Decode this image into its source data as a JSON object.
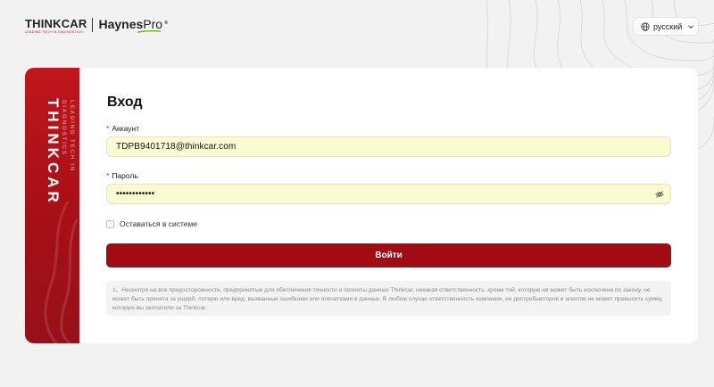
{
  "header": {
    "logo_thinkcar": "THINKCAR",
    "logo_thinkcar_tagline": "LEADING TECH IN DIAGNOSTICS",
    "logo_haynes": "Haynes",
    "logo_pro": "Pro",
    "logo_reg": "®",
    "language": "русский"
  },
  "banner": {
    "brand": "THINKCAR",
    "tagline_line1": "LEADING TECH IN",
    "tagline_line2": "DIAGNOSTICS"
  },
  "login": {
    "title": "Вход",
    "account_label": "Аккаунт",
    "account_value": "TDPB9401718@thinkcar.com",
    "password_label": "Пароль",
    "password_value": "••••••••••••",
    "remember_label": "Оставаться в системе",
    "submit_label": "Войти",
    "disclaimer": "1、Несмотря на все предосторожности, предпринятые для обеспечения точности и полноты данных Thinkcar, никакая ответственность, кроме той, которую не может быть исключена по закону, не может быть принята за ущерб, потерю или вред, вызванные ошибками или опечатками в данных. В любом случае ответственность компании, ее дистрибьюторов и агентов не может превысить сумму, которую вы заплатили за Thinkcar."
  },
  "colors": {
    "brand_red": "#a10c12",
    "banner_red": "#c0161d",
    "autofill_yellow": "#fbfbd2",
    "background": "#f2f2f3"
  },
  "icons": [
    "globe-icon",
    "chevron-down-icon",
    "eye-off-icon"
  ]
}
